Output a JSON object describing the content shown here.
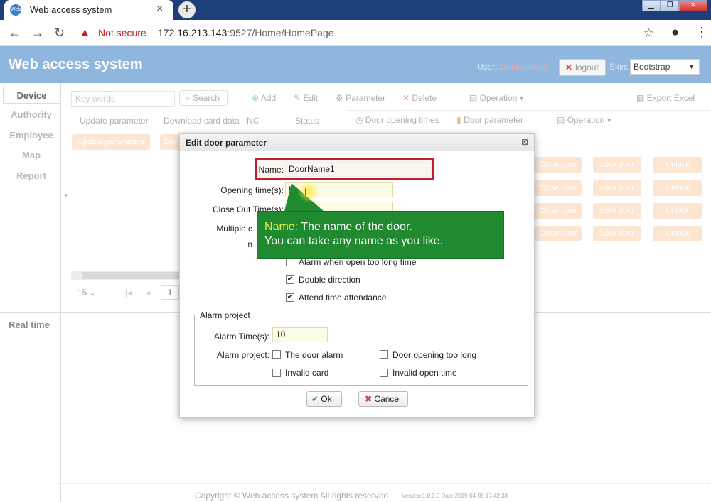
{
  "browser": {
    "tab_title": "Web access system",
    "favicon": "Web",
    "address_warning": "Not secure",
    "url_host": "172.16.213.143",
    "url_rest": ":9527/Home/HomePage",
    "icons": [
      "back-icon",
      "forward-icon",
      "reload-icon",
      "star-icon",
      "account-icon",
      "menu-icon"
    ]
  },
  "header": {
    "title": "Web access system",
    "user_label": "User:",
    "user_name": "administrator",
    "logout_label": "logout",
    "skin_label": "Skin:",
    "skin_value": "Bootstrap"
  },
  "sidebar": {
    "items": [
      {
        "label": "Device"
      },
      {
        "label": "Authority"
      },
      {
        "label": "Employee"
      },
      {
        "label": "Map"
      },
      {
        "label": "Report"
      }
    ],
    "realtime": "Real time"
  },
  "toolbar": {
    "keyword_placeholder": "Key words",
    "search": "Search",
    "add": "Add",
    "edit": "Edit",
    "parameter": "Parameter",
    "delete": "Delete",
    "operation": "Operation",
    "export": "Export Excel"
  },
  "subtoolbar": {
    "update_parameter": "Update parameter",
    "download_card_data": "Download card data",
    "nc": "NC",
    "status": "Status",
    "door_opening_times": "Door opening times",
    "door_parameter": "Door parameter",
    "operation": "Operation",
    "update_parameters_btn": "Update parameters",
    "dov_btn": "Dov"
  },
  "door_rows": [
    {
      "close": "Close door",
      "lock": "Lock door",
      "unlock": "Unlock"
    },
    {
      "close": "Close door",
      "lock": "Lock door",
      "unlock": "Unlock"
    },
    {
      "close": "Close door",
      "lock": "Lock door",
      "unlock": "Unlock"
    },
    {
      "close": "Close door",
      "lock": "Lock door",
      "unlock": "Unlock"
    }
  ],
  "pager": {
    "page_size": "15",
    "page": "1"
  },
  "dialog": {
    "title": "Edit door parameter",
    "name_label": "Name:",
    "name_value": "DoorName1",
    "opening_time_label": "Opening time(s):",
    "opening_time_value": "5",
    "close_out_label": "Close Out Time(s):",
    "multiple_label": "Multiple c",
    "n_label": "n",
    "alarm_open_long": "Alarm when open too long time",
    "double_direction": "Double direction",
    "attend_time": "Attend time attendance",
    "alarm_project_legend": "Alarm project",
    "alarm_time_label": "Alarm Time(s):",
    "alarm_time_value": "10",
    "alarm_project_label": "Alarm project:",
    "door_alarm": "The door alarm",
    "door_open_long": "Door opening too long",
    "invalid_card": "Invalid card",
    "invalid_open_time": "Invalid open time",
    "ok": "Ok",
    "cancel": "Cancel"
  },
  "tooltip": {
    "keyword": "Name:",
    "line1": " The name of the door.",
    "line2": "You can take any name  as you like."
  },
  "footer": {
    "copyright": "Copyright © Web access system All rights reserved",
    "version": "Version:1.0.0.0 Date:2019-04-03 17:42:38"
  }
}
